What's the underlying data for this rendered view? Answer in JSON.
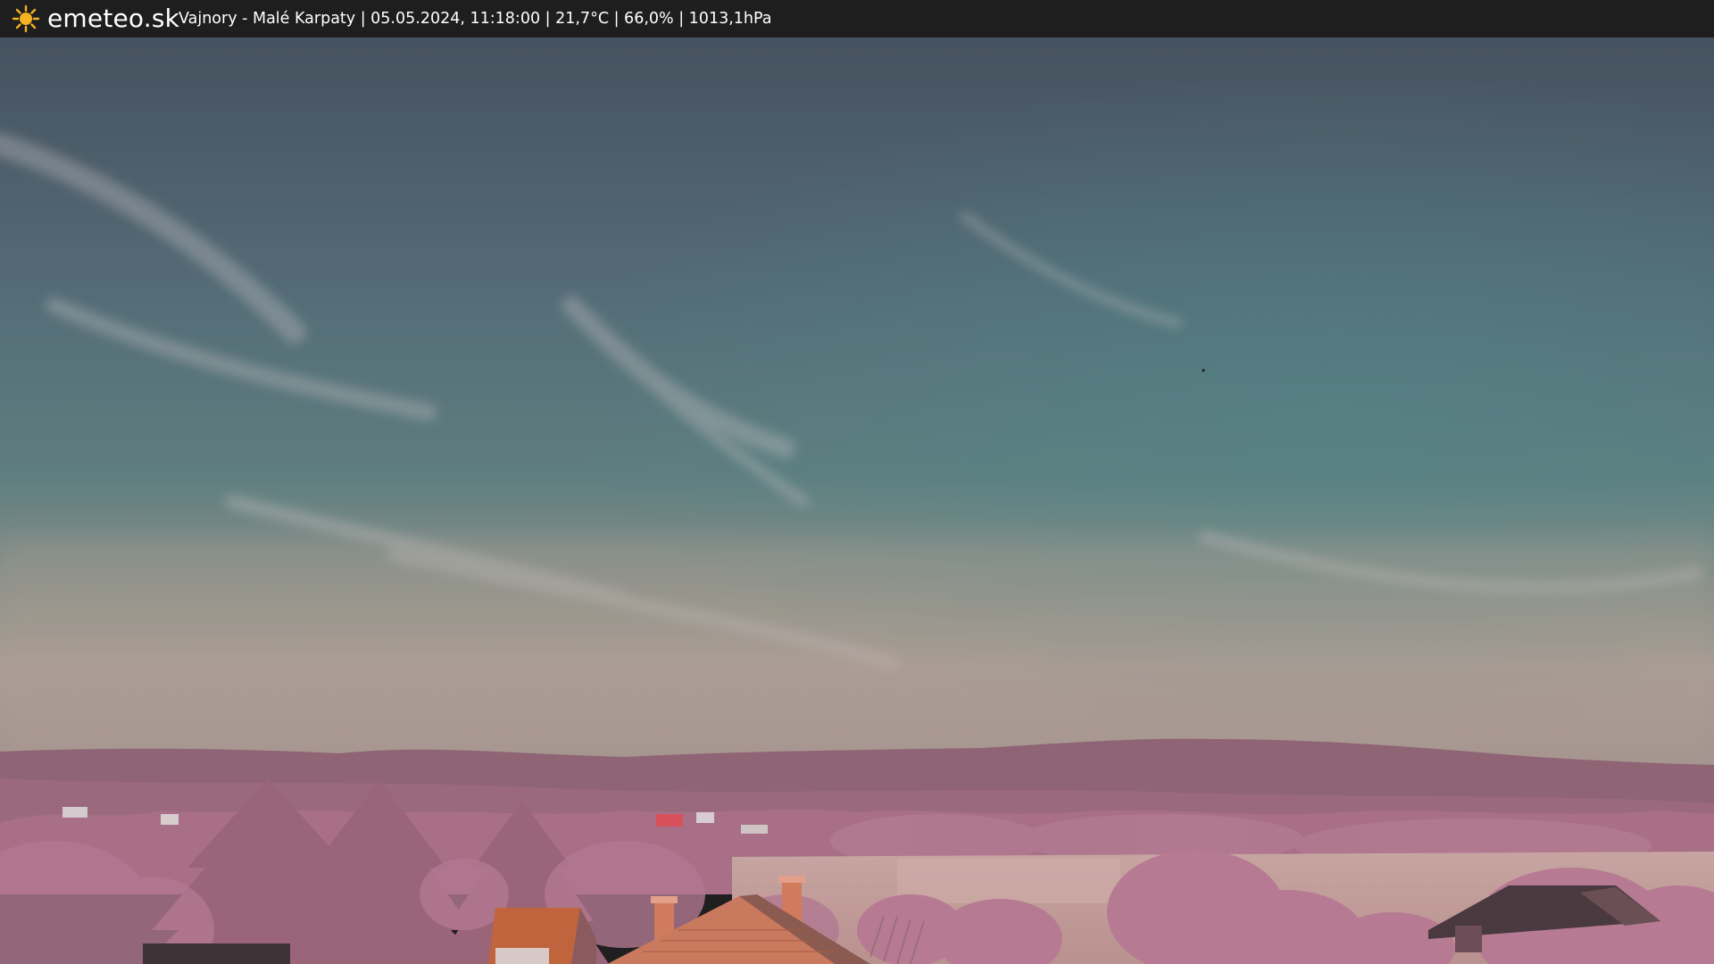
{
  "brand": {
    "name": "emeteo.sk",
    "icon": "sun-icon",
    "icon_color": "#f5b324"
  },
  "caption": {
    "text": "Vajnory - Malé Karpaty | 05.05.2024, 11:18:00 | 21,7°C | 66,0% | 1013,1hPa",
    "location": "Vajnory - Malé Karpaty",
    "datetime": "05.05.2024, 11:18:00",
    "temperature": "21,7°C",
    "humidity": "66,0%",
    "pressure": "1013,1hPa"
  },
  "colors": {
    "bar_background": "#1e1e1e",
    "sky_top": "#4b5d6a",
    "sky_mid": "#58757a",
    "sky_horizon": "#a79a92",
    "hills": "#8e6374",
    "trees": "#a56f85",
    "roof": "#c0643e",
    "field": "#c8a49f"
  }
}
